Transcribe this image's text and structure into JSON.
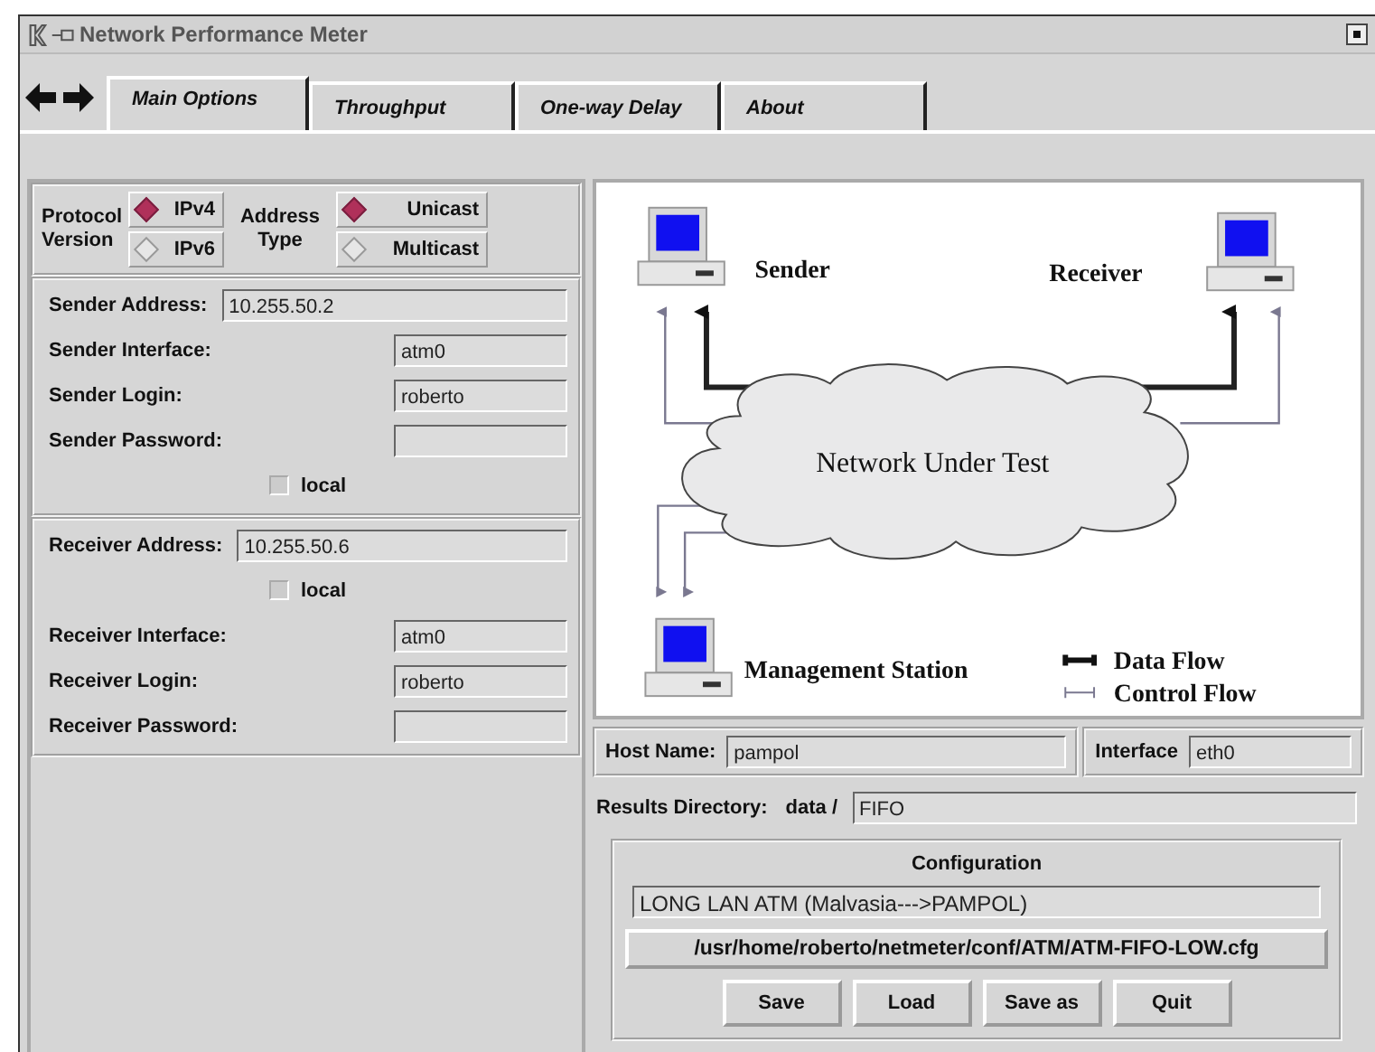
{
  "window": {
    "title": "Network Performance Meter"
  },
  "tabs": [
    {
      "label": "Main Options",
      "selected": true
    },
    {
      "label": "Throughput",
      "selected": false
    },
    {
      "label": "One-way Delay",
      "selected": false
    },
    {
      "label": "About",
      "selected": false
    }
  ],
  "protocol": {
    "label": "Protocol Version",
    "options": [
      {
        "label": "IPv4",
        "selected": true
      },
      {
        "label": "IPv6",
        "selected": false
      }
    ]
  },
  "address_type": {
    "label": "Address Type",
    "options": [
      {
        "label": "Unicast",
        "selected": true
      },
      {
        "label": "Multicast",
        "selected": false
      }
    ]
  },
  "sender": [
    {
      "kind": "wide",
      "label": "Sender Address:",
      "value": "10.255.50.2"
    },
    {
      "kind": "field",
      "label": "Sender Interface:",
      "value": "atm0"
    },
    {
      "kind": "field",
      "label": "Sender Login:",
      "value": "roberto"
    },
    {
      "kind": "field",
      "label": "Sender Password:"
    },
    {
      "kind": "checkbox",
      "label": "local",
      "checked": false
    }
  ],
  "receiver": [
    {
      "kind": "wide",
      "label": "Receiver Address:",
      "value": "10.255.50.6"
    },
    {
      "kind": "checkbox",
      "label": "local",
      "checked": false
    },
    {
      "kind": "field",
      "label": "Receiver Interface:",
      "value": "atm0"
    },
    {
      "kind": "field",
      "label": "Receiver Login:",
      "value": "roberto"
    },
    {
      "kind": "field",
      "label": "Receiver Password:"
    }
  ],
  "diagram": {
    "sender": "Sender",
    "receiver": "Receiver",
    "network": "Network Under Test",
    "management": "Management Station",
    "legend": [
      {
        "kind": "data",
        "label": "Data Flow"
      },
      {
        "kind": "control",
        "label": "Control Flow"
      }
    ]
  },
  "host": {
    "label": "Host Name:",
    "value": "pampol"
  },
  "interface": {
    "label": "Interface",
    "value": "eth0"
  },
  "results": {
    "label": "Results Directory:",
    "prefix": "data /",
    "value": "FIFO"
  },
  "configuration": {
    "title": "Configuration",
    "name": "LONG LAN ATM (Malvasia--->PAMPOL)",
    "path": "/usr/home/roberto/netmeter/conf/ATM/ATM-FIFO-LOW.cfg",
    "buttons": [
      "Save",
      "Load",
      "Save as",
      "Quit"
    ]
  }
}
